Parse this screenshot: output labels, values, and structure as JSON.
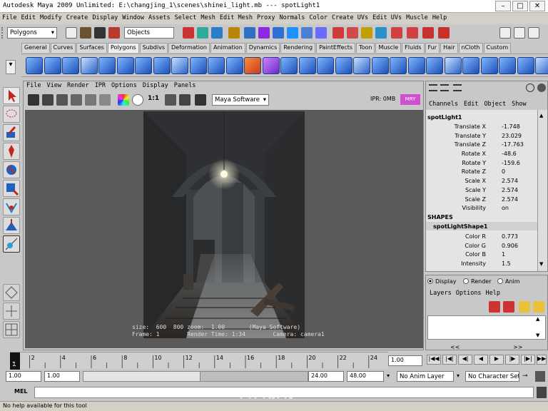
{
  "window": {
    "title": "Autodesk Maya 2009 Unlimited: E:\\changjing_1\\scenes\\shinei_light.mb    ---    spotLight1"
  },
  "menubar": {
    "items": [
      "File",
      "Edit",
      "Modify",
      "Create",
      "Display",
      "Window",
      "Assets",
      "Select",
      "Mesh",
      "Edit Mesh",
      "Proxy",
      "Normals",
      "Color",
      "Create UVs",
      "Edit UVs",
      "Muscle",
      "Help"
    ]
  },
  "statusline": {
    "menuset": "Polygons",
    "selection_mode": "Objects"
  },
  "shelf": {
    "tabs": [
      "General",
      "Curves",
      "Surfaces",
      "Polygons",
      "Subdivs",
      "Deformation",
      "Animation",
      "Dynamics",
      "Rendering",
      "PaintEffects",
      "Toon",
      "Muscle",
      "Fluids",
      "Fur",
      "Hair",
      "nCloth",
      "Custom"
    ],
    "active": "Polygons"
  },
  "viewport": {
    "menu": [
      "File",
      "View",
      "Render",
      "IPR",
      "Options",
      "Display",
      "Panels"
    ],
    "ratio_label": "1:1",
    "renderer": "Maya Software",
    "ipr_label": "IPR: 0MB",
    "hud_line1": "size:  600  800 zoom:  1.00       (Maya Software)",
    "hud_line2": "Frame: 1        Render Time: 1:34        Camera: camera1"
  },
  "channelbox": {
    "menu": [
      "Channels",
      "Edit",
      "Object",
      "Show"
    ],
    "node": "spotLight1",
    "attrs": [
      {
        "name": "Translate X",
        "value": "-1.748"
      },
      {
        "name": "Translate Y",
        "value": "23.029"
      },
      {
        "name": "Translate Z",
        "value": "-17.763"
      },
      {
        "name": "Rotate X",
        "value": "-48.6"
      },
      {
        "name": "Rotate Y",
        "value": "-159.6"
      },
      {
        "name": "Rotate Z",
        "value": "0"
      },
      {
        "name": "Scale X",
        "value": "2.574"
      },
      {
        "name": "Scale Y",
        "value": "2.574"
      },
      {
        "name": "Scale Z",
        "value": "2.574"
      },
      {
        "name": "Visibility",
        "value": "on"
      }
    ],
    "shapes_header": "SHAPES",
    "shape_node": "spotLightShape1",
    "shape_attrs": [
      {
        "name": "Color R",
        "value": "0.773"
      },
      {
        "name": "Color G",
        "value": "0.906"
      },
      {
        "name": "Color B",
        "value": "1"
      },
      {
        "name": "Intensity",
        "value": "1.5"
      }
    ]
  },
  "layers": {
    "modes": [
      "Display",
      "Render",
      "Anim"
    ],
    "selected_mode": "Display",
    "menu": [
      "Layers",
      "Options",
      "Help"
    ]
  },
  "timeline": {
    "ticks": [
      "2",
      "4",
      "6",
      "8",
      "10",
      "12",
      "14",
      "16",
      "18",
      "20",
      "22",
      "24"
    ],
    "current_frame": "1",
    "current_time": "1.00",
    "scroll_arrows": [
      "<<",
      ">>"
    ]
  },
  "range": {
    "start": "1.00",
    "playback_start": "1.00",
    "playback_end": "24.00",
    "end": "48.00",
    "anim_layer": "No Anim Layer",
    "character_set": "No Character Set"
  },
  "command": {
    "label": "MEL"
  },
  "helpline": {
    "text": "No help available for this tool"
  },
  "watermark": {
    "text": "人人素材"
  }
}
